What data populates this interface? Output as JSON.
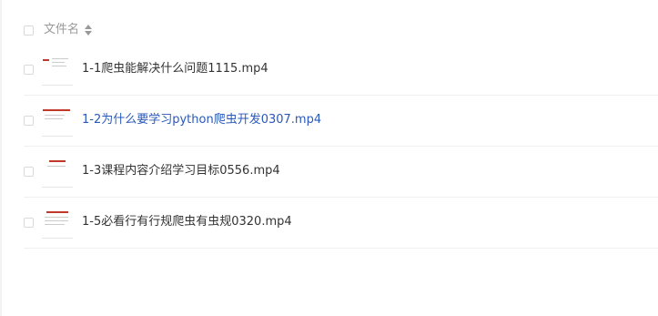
{
  "header": {
    "column_label": "文件名"
  },
  "files": [
    {
      "name": "1-1爬虫能解决什么问题1115.mp4",
      "active": false
    },
    {
      "name": "1-2为什么要学习python爬虫开发0307.mp4",
      "active": true
    },
    {
      "name": "1-3课程内容介绍学习目标0556.mp4",
      "active": false
    },
    {
      "name": "1-5必看行有行规爬虫有虫规0320.mp4",
      "active": false
    }
  ],
  "colors": {
    "active_link": "#2a59b8",
    "text": "#333333",
    "muted": "#999999"
  },
  "icons": {
    "sort": "sort-icon",
    "thumbnail": "video-thumbnail-icon"
  }
}
